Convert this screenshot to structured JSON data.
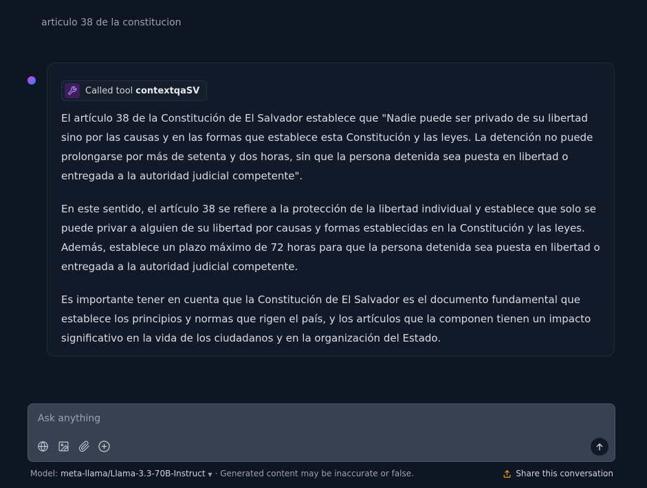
{
  "user_message": "articulo 38 de la constitucion",
  "tool_call": {
    "prefix": "Called tool",
    "name": "contextqaSV",
    "icon": "wrench-icon"
  },
  "answer": {
    "paragraphs": [
      "El artículo 38 de la Constitución de El Salvador establece que \"Nadie puede ser privado de su libertad sino por las causas y en las formas que establece esta Constitución y las leyes. La detención no puede prolongarse por más de setenta y dos horas, sin que la persona detenida sea puesta en libertad o entregada a la autoridad judicial competente\".",
      "En este sentido, el artículo 38 se refiere a la protección de la libertad individual y establece que solo se puede privar a alguien de su libertad por causas y formas establecidas en la Constitución y las leyes. Además, establece un plazo máximo de 72 horas para que la persona detenida sea puesta en libertad o entregada a la autoridad judicial competente.",
      "Es importante tener en cuenta que la Constitución de El Salvador es el documento fundamental que establece los principios y normas que rigen el país, y los artículos que la componen tienen un impacto significativo en la vida de los ciudadanos y en la organización del Estado."
    ]
  },
  "composer": {
    "placeholder": "Ask anything",
    "tools": [
      "globe-icon",
      "image-edit-icon",
      "paperclip-icon",
      "plus-icon"
    ],
    "send_icon": "arrow-up-icon"
  },
  "footer": {
    "model_prefix": "Model:",
    "model_name": "meta-llama/Llama-3.3-70B-Instruct",
    "disclaimer": "· Generated content may be inaccurate or false.",
    "share_label": "Share this conversation",
    "share_icon": "upload-icon"
  },
  "colors": {
    "background": "#0f1623",
    "card": "#121a29",
    "composer": "#374151",
    "accent_share": "#f59e0b"
  }
}
